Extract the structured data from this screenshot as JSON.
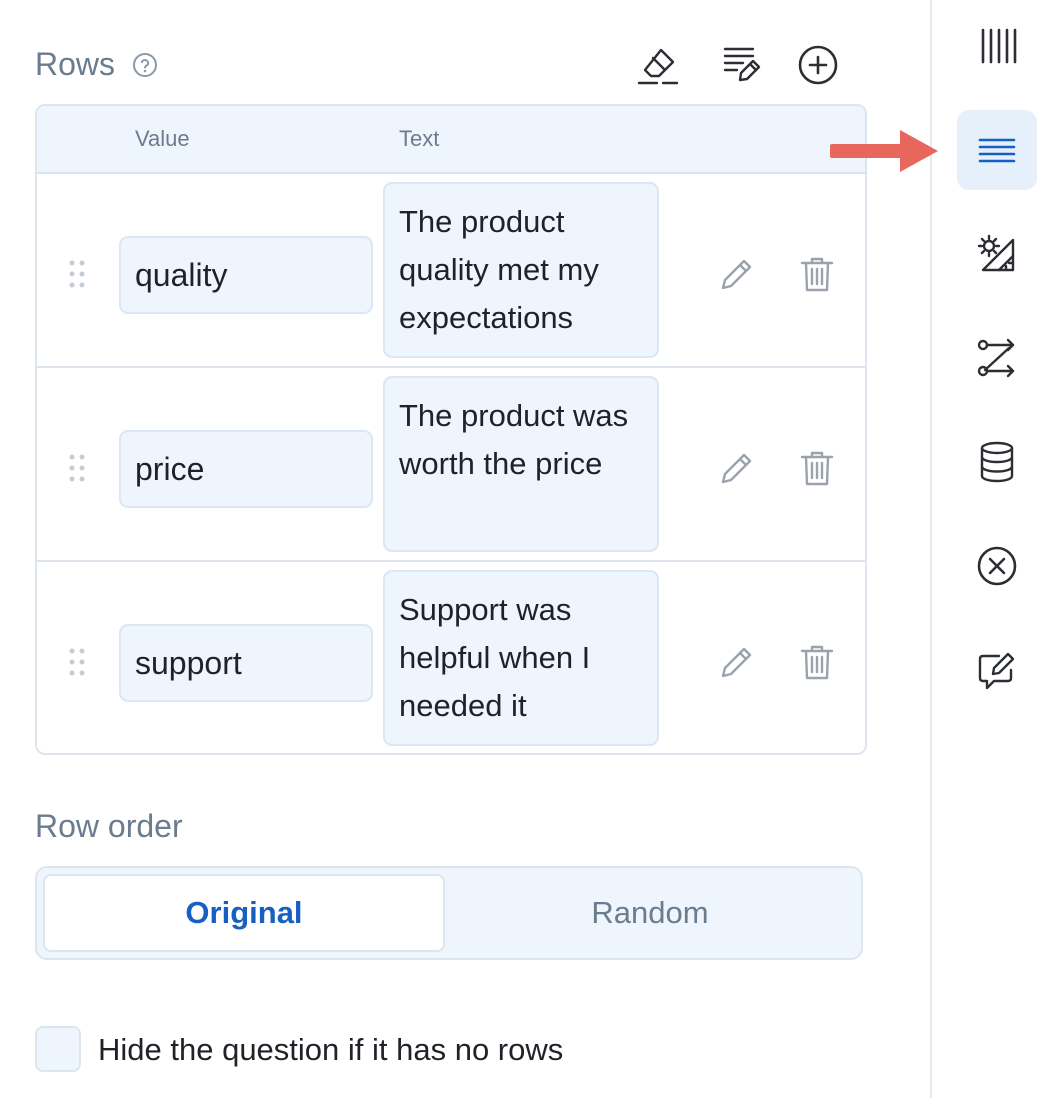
{
  "rows_section": {
    "title": "Rows",
    "help_icon": "question-circle-icon",
    "toolbar": [
      {
        "icon": "eraser-icon",
        "action": "clear"
      },
      {
        "icon": "edit-list-icon",
        "action": "edit"
      },
      {
        "icon": "plus-circle-icon",
        "action": "add"
      }
    ],
    "columns": {
      "value": "Value",
      "text": "Text"
    },
    "rows": [
      {
        "value": "quality",
        "text": "The product quality met my expectations"
      },
      {
        "value": "price",
        "text": "The product was worth the price"
      },
      {
        "value": "support",
        "text": "Support was helpful when I needed it"
      }
    ]
  },
  "row_order": {
    "label": "Row order",
    "options": [
      "Original",
      "Random"
    ],
    "selected": "Original"
  },
  "hide_question": {
    "label": "Hide the question if it has no rows",
    "checked": false
  },
  "sidebar": {
    "items": [
      {
        "icon": "columns-icon",
        "active": false
      },
      {
        "icon": "rows-icon",
        "active": true
      },
      {
        "icon": "settings-ruler-icon",
        "active": false
      },
      {
        "icon": "logic-flow-icon",
        "active": false
      },
      {
        "icon": "database-icon",
        "active": false
      },
      {
        "icon": "close-circle-icon",
        "active": false
      },
      {
        "icon": "comment-edit-icon",
        "active": false
      }
    ]
  },
  "colors": {
    "accent": "#1660c4",
    "field_bg": "#eef5fd",
    "border": "#dde6ef",
    "muted_text": "#6b7c8f",
    "icon": "#2b2f33",
    "arrow": "#e8675c"
  }
}
